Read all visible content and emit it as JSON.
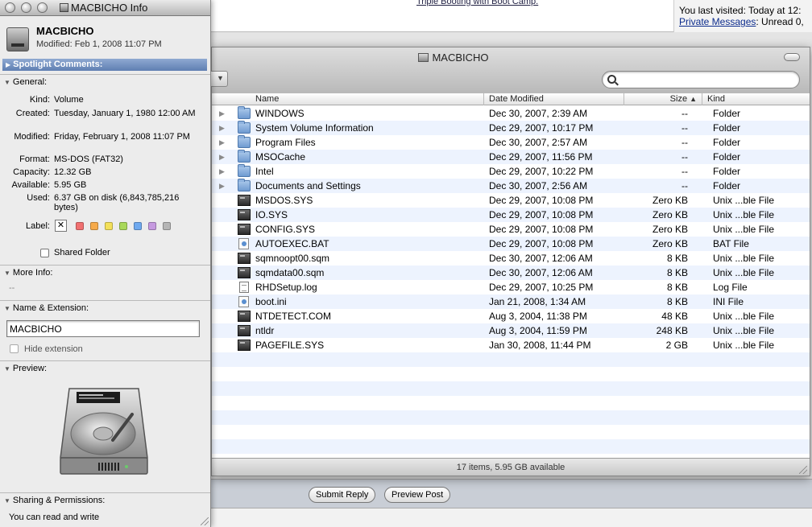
{
  "background_page": {
    "link_text": "Triple Booting with Boot Camp.",
    "last_visited": "You last visited: Today at 12:",
    "private_messages_label": "Private Messages",
    "private_messages_suffix": ": Unread 0,",
    "submit_reply_label": "Submit Reply",
    "preview_post_label": "Preview Post"
  },
  "finder": {
    "title": "MACBICHO",
    "search_placeholder": "",
    "columns": {
      "name": "Name",
      "date": "Date Modified",
      "size": "Size",
      "kind": "Kind"
    },
    "sort_indicator": "▲",
    "rows": [
      {
        "name": "WINDOWS",
        "date": "Dec 30, 2007, 2:39 AM",
        "size": "--",
        "kind": "Folder",
        "icon": "folder-icon",
        "expandable": true
      },
      {
        "name": "System Volume Information",
        "date": "Dec 29, 2007, 10:17 PM",
        "size": "--",
        "kind": "Folder",
        "icon": "folder-icon",
        "expandable": true
      },
      {
        "name": "Program Files",
        "date": "Dec 30, 2007, 2:57 AM",
        "size": "--",
        "kind": "Folder",
        "icon": "folder-icon",
        "expandable": true
      },
      {
        "name": "MSOCache",
        "date": "Dec 29, 2007, 11:56 PM",
        "size": "--",
        "kind": "Folder",
        "icon": "folder-icon",
        "expandable": true
      },
      {
        "name": "Intel",
        "date": "Dec 29, 2007, 10:22 PM",
        "size": "--",
        "kind": "Folder",
        "icon": "folder-icon",
        "expandable": true
      },
      {
        "name": "Documents and Settings",
        "date": "Dec 30, 2007, 2:56 AM",
        "size": "--",
        "kind": "Folder",
        "icon": "folder-icon",
        "expandable": true
      },
      {
        "name": "MSDOS.SYS",
        "date": "Dec 29, 2007, 10:08 PM",
        "size": "Zero KB",
        "kind": "Unix ...ble File",
        "icon": "executable-icon",
        "expandable": false
      },
      {
        "name": "IO.SYS",
        "date": "Dec 29, 2007, 10:08 PM",
        "size": "Zero KB",
        "kind": "Unix ...ble File",
        "icon": "executable-icon",
        "expandable": false
      },
      {
        "name": "CONFIG.SYS",
        "date": "Dec 29, 2007, 10:08 PM",
        "size": "Zero KB",
        "kind": "Unix ...ble File",
        "icon": "executable-icon",
        "expandable": false
      },
      {
        "name": "AUTOEXEC.BAT",
        "date": "Dec 29, 2007, 10:08 PM",
        "size": "Zero KB",
        "kind": "BAT File",
        "icon": "script-icon",
        "expandable": false
      },
      {
        "name": "sqmnoopt00.sqm",
        "date": "Dec 30, 2007, 12:06 AM",
        "size": "8 KB",
        "kind": "Unix ...ble File",
        "icon": "executable-icon",
        "expandable": false
      },
      {
        "name": "sqmdata00.sqm",
        "date": "Dec 30, 2007, 12:06 AM",
        "size": "8 KB",
        "kind": "Unix ...ble File",
        "icon": "executable-icon",
        "expandable": false
      },
      {
        "name": "RHDSetup.log",
        "date": "Dec 29, 2007, 10:25 PM",
        "size": "8 KB",
        "kind": "Log File",
        "icon": "document-icon",
        "expandable": false
      },
      {
        "name": "boot.ini",
        "date": "Jan 21, 2008, 1:34 AM",
        "size": "8 KB",
        "kind": "INI File",
        "icon": "script-icon",
        "expandable": false
      },
      {
        "name": "NTDETECT.COM",
        "date": "Aug 3, 2004, 11:38 PM",
        "size": "48 KB",
        "kind": "Unix ...ble File",
        "icon": "executable-icon",
        "expandable": false
      },
      {
        "name": "ntldr",
        "date": "Aug 3, 2004, 11:59 PM",
        "size": "248 KB",
        "kind": "Unix ...ble File",
        "icon": "executable-icon",
        "expandable": false
      },
      {
        "name": "PAGEFILE.SYS",
        "date": "Jan 30, 2008, 11:44 PM",
        "size": "2 GB",
        "kind": "Unix ...ble File",
        "icon": "executable-icon",
        "expandable": false
      }
    ],
    "status": "17 items, 5.95 GB available"
  },
  "info": {
    "window_title": "MACBICHO Info",
    "volume_name": "MACBICHO",
    "modified_summary": "Modified: Feb 1, 2008 11:07 PM",
    "spotlight_label": "Spotlight Comments:",
    "general_label": "General:",
    "general": {
      "kind_label": "Kind:",
      "kind": "Volume",
      "created_label": "Created:",
      "created": "Tuesday, January 1, 1980 12:00 AM",
      "modified_label": "Modified:",
      "modified": "Friday, February 1, 2008 11:07 PM",
      "format_label": "Format:",
      "format": "MS-DOS (FAT32)",
      "capacity_label": "Capacity:",
      "capacity": "12.32 GB",
      "available_label": "Available:",
      "available": "5.95 GB",
      "used_label": "Used:",
      "used": "6.37 GB on disk (6,843,785,216 bytes)",
      "label_label": "Label:",
      "label_none": "✕"
    },
    "label_colors": [
      "#f07070",
      "#f6aa4a",
      "#f3e05a",
      "#a9d85a",
      "#6fa9ef",
      "#c69ae0",
      "#b5b5b5"
    ],
    "shared_folder_label": "Shared Folder",
    "more_info_label": "More Info:",
    "more_info_value": "--",
    "name_ext_label": "Name & Extension:",
    "name_value": "MACBICHO",
    "hide_extension_label": "Hide extension",
    "preview_label": "Preview:",
    "sharing_label": "Sharing & Permissions:",
    "sharing_value": "You can read and write"
  }
}
